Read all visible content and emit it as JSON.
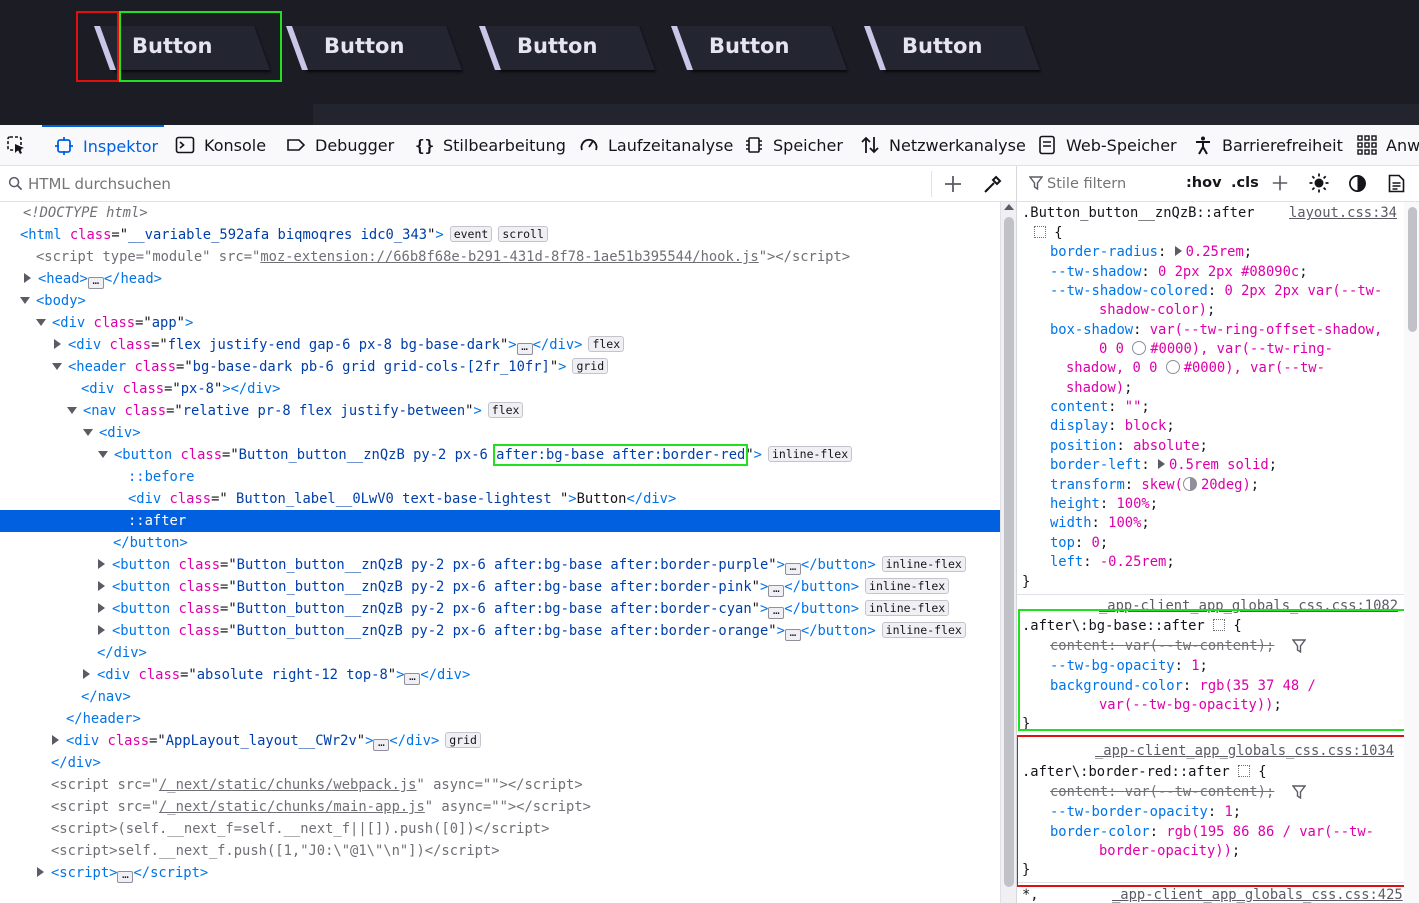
{
  "preview": {
    "buttons": [
      {
        "label": "Button"
      },
      {
        "label": "Button"
      },
      {
        "label": "Button"
      },
      {
        "label": "Button"
      },
      {
        "label": "Button"
      }
    ]
  },
  "toolbar": {
    "tabs": [
      {
        "label": "Inspektor",
        "icon": "inspector-icon"
      },
      {
        "label": "Konsole",
        "icon": "console-icon"
      },
      {
        "label": "Debugger",
        "icon": "debugger-icon"
      },
      {
        "label": "Stilbearbeitung",
        "icon": "style-editor-icon"
      },
      {
        "label": "Laufzeitanalyse",
        "icon": "performance-icon"
      },
      {
        "label": "Speicher",
        "icon": "memory-icon"
      },
      {
        "label": "Netzwerkanalyse",
        "icon": "network-icon"
      },
      {
        "label": "Web-Speicher",
        "icon": "storage-icon"
      },
      {
        "label": "Barrierefreiheit",
        "icon": "accessibility-icon"
      },
      {
        "label": "Anw",
        "icon": "application-icon"
      }
    ]
  },
  "markup_search": {
    "placeholder": "HTML durchsuchen"
  },
  "rules_toolbar": {
    "placeholder": "Stile filtern",
    "hov": ":hov",
    "cls": ".cls"
  },
  "tree": {
    "doctype": "<!DOCTYPE html>",
    "html_class": "__variable_592afa biqmoqres idc0_343",
    "script_type": "module",
    "script_src": "moz-extension://66b8f68e-b291-431d-8f78-1ae51b395544/hook.js",
    "app_class": "app",
    "div_flex_class": "flex justify-end gap-6 px-8 bg-base-dark",
    "header_class": "bg-base-dark pb-6 grid grid-cols-[2fr_10fr]",
    "px8_class": "px-8",
    "nav_class": "relative pr-8 flex justify-between",
    "button_class_base": "Button_button__znQzB py-2 px-6 ",
    "button_class_hl": "after:bg-base after:border-red",
    "before": "::before",
    "label_class": " Button_label__0LwV0 text-base-lightest ",
    "label_text": "Button",
    "after": "::after",
    "btn_purple": "Button_button__znQzB py-2 px-6 after:bg-base after:border-purple",
    "btn_pink": "Button_button__znQzB py-2 px-6 after:bg-base after:border-pink",
    "btn_cyan": "Button_button__znQzB py-2 px-6 after:bg-base after:border-cyan",
    "btn_orange": "Button_button__znQzB py-2 px-6 after:bg-base after:border-orange",
    "abs_class": "absolute right-12 top-8",
    "applayout_class": "AppLayout_layout__CWr2v",
    "webpack_src": "/_next/static/chunks/webpack.js",
    "mainapp_src": "/_next/static/chunks/main-app.js",
    "async_val": "",
    "inline1": "(self.__next_f=self.__next_f||[]).push([0])",
    "inline2": "self.__next_f.push([1,\"J0:\\\"@1\\\"\\n\"])",
    "badges": {
      "event": "event",
      "scroll": "scroll",
      "flex": "flex",
      "grid": "grid",
      "inline_flex": "inline-flex"
    }
  },
  "rules": {
    "rule1": {
      "selector": ".Button_button__znQzB::after",
      "source": "layout.css:34",
      "border_radius": "0.25rem",
      "tw_shadow": "0 2px 2px #08090c",
      "tw_shadow_colored_1": "0 2px 2px var(--tw-",
      "tw_shadow_colored_2": "shadow-color)",
      "box_shadow_1": "var(--tw-ring-offset-shadow,",
      "box_shadow_2a": "0 0",
      "box_shadow_2b": "#0000), var(--tw-ring-",
      "box_shadow_3a": "shadow, 0 0",
      "box_shadow_3b": "#0000), var(--tw-",
      "box_shadow_4": "shadow)",
      "content": "\"\"",
      "display": "block",
      "position": "absolute",
      "border_left": "0.5rem solid",
      "transform_a": "skew(",
      "transform_b": "20deg)",
      "height": "100%",
      "width": "100%",
      "top": "0",
      "left": "-0.25rem"
    },
    "rule2": {
      "source": "_app-client_app_globals_css.css:1082",
      "selector": ".after\\:bg-base::after",
      "content": "var(--tw-content)",
      "tw_bg_opacity": "1",
      "bg_color_1": "rgb(35 37 48 /",
      "bg_color_2": "var(--tw-bg-opacity))"
    },
    "rule3": {
      "source": "_app-client_app_globals_css.css:1034",
      "selector": ".after\\:border-red::after",
      "content": "var(--tw-content)",
      "tw_border_opacity": "1",
      "border_color_1": "rgb(195 86 86 / var(--tw-",
      "border_color_2": "border-opacity))"
    },
    "rule4": {
      "source": "_app-client_app_globals_css.css:425"
    }
  },
  "colors": {
    "accent": "#0061e0",
    "selected": "#0060df",
    "red": "#e01010",
    "green": "#20e020",
    "preview_bg": "#1b1c24"
  }
}
